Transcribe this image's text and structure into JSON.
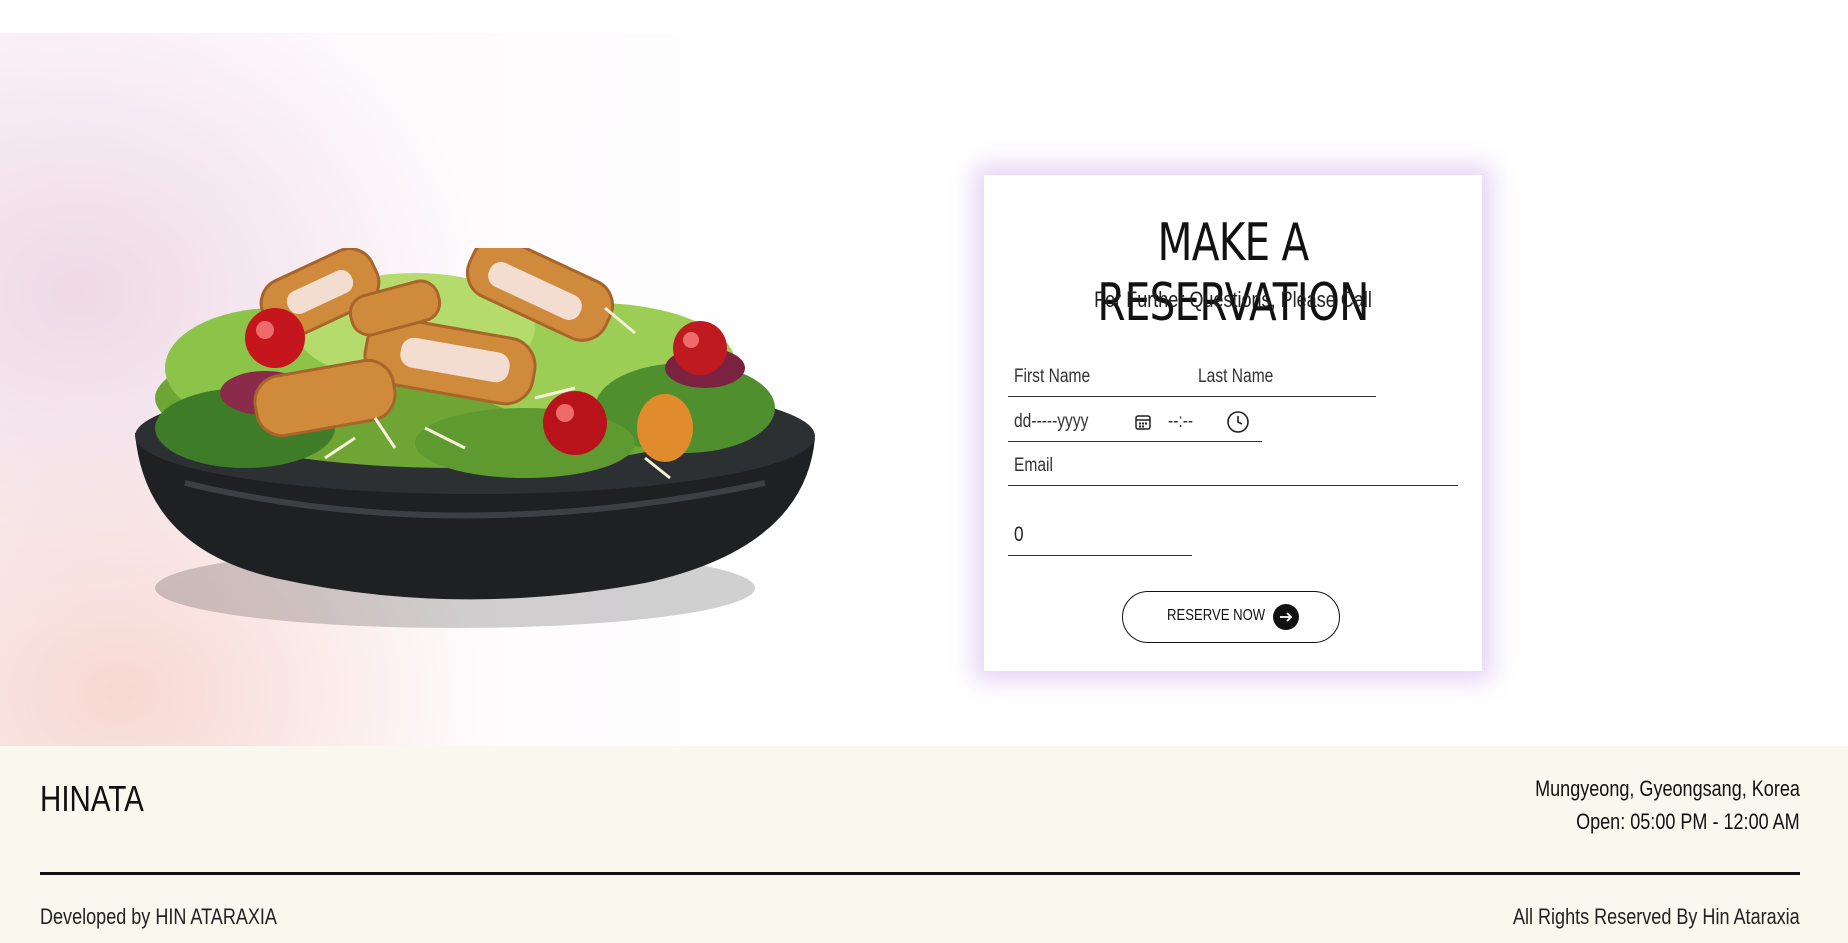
{
  "reservation": {
    "title": "MAKE A RESERVATION",
    "subtitle": "For Further Questions, Please Call",
    "first_name_placeholder": "First Name",
    "last_name_placeholder": "Last Name",
    "date_placeholder": "dd-----yyyy",
    "time_placeholder": "--:--",
    "email_placeholder": "Email",
    "guests_value": "0",
    "reserve_label": "RESERVE NOW"
  },
  "footer": {
    "brand": "HINATA",
    "address": "Mungyeong, Gyeongsang, Korea",
    "hours": "Open: 05:00 PM - 12:00 AM",
    "developed_by": "Developed by HIN ATARAXIA",
    "rights": "All Rights Reserved By Hin Ataraxia"
  },
  "icons": {
    "calendar": "calendar-icon",
    "clock": "clock-icon",
    "arrow": "arrow-right-icon"
  },
  "colors": {
    "card_glow": "#c8a0eb",
    "footer_bg": "#f8f8ef",
    "text": "#111111"
  }
}
